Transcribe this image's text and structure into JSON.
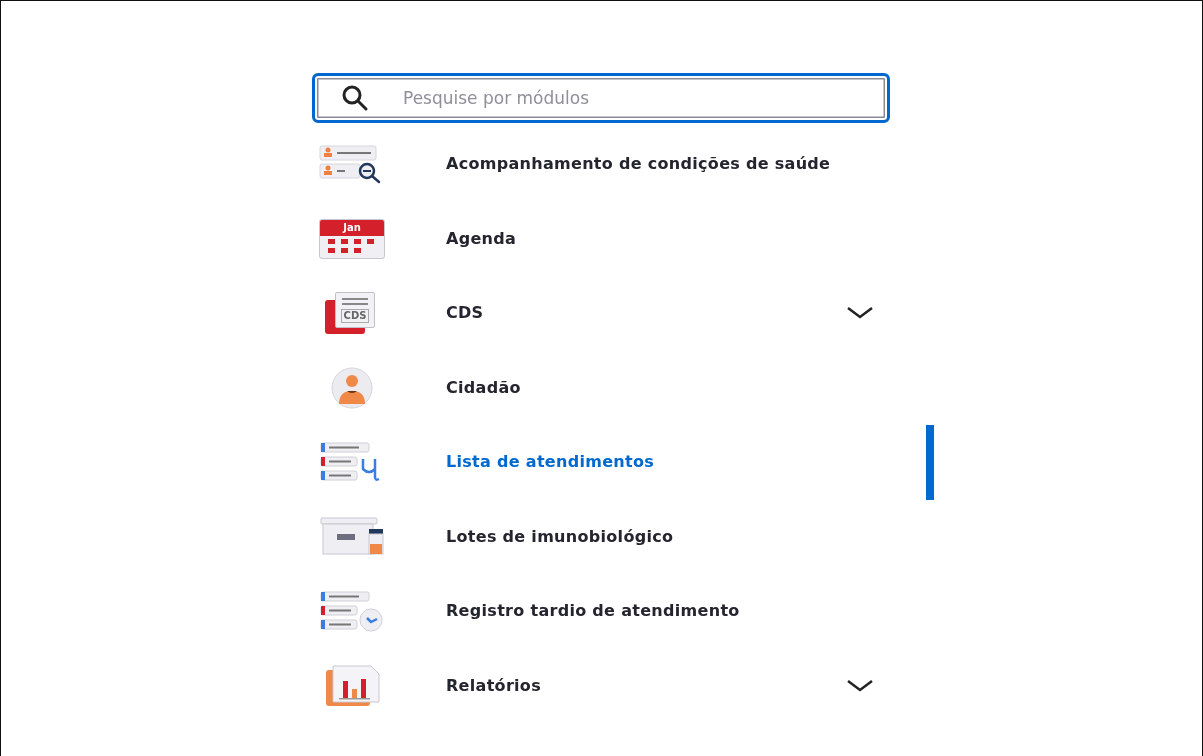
{
  "search": {
    "placeholder": "Pesquise por módulos"
  },
  "modules": [
    {
      "label": "Acompanhamento de condições de saúde",
      "kind": "conditions",
      "expandable": false,
      "selected": false
    },
    {
      "label": "Agenda",
      "kind": "calendar",
      "icon_text": "Jan",
      "expandable": false,
      "selected": false
    },
    {
      "label": "CDS",
      "kind": "document",
      "icon_text": "CDS",
      "expandable": true,
      "selected": false
    },
    {
      "label": "Cidadão",
      "kind": "person",
      "expandable": false,
      "selected": false
    },
    {
      "label": "Lista de atendimentos",
      "kind": "list",
      "expandable": false,
      "selected": true
    },
    {
      "label": "Lotes de imunobiológico",
      "kind": "box",
      "expandable": false,
      "selected": false
    },
    {
      "label": "Registro tardio de atendimento",
      "kind": "clock",
      "expandable": false,
      "selected": false
    },
    {
      "label": "Relatórios",
      "kind": "report",
      "expandable": true,
      "selected": false
    }
  ]
}
